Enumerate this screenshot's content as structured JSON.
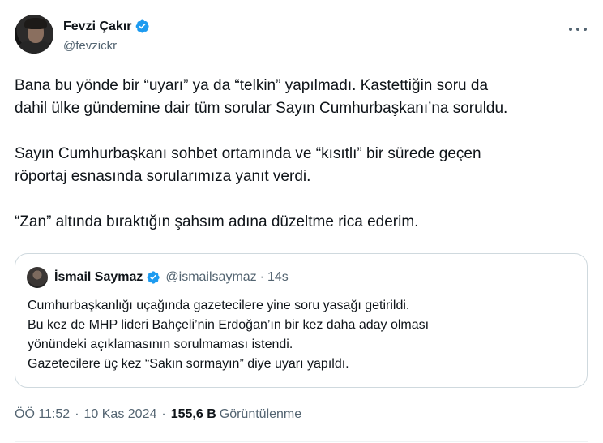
{
  "author": {
    "display_name": "Fevzi Çakır",
    "handle": "@fevzickr"
  },
  "tweet": {
    "paragraphs": [
      "Bana bu yönde bir “uyarı” ya da “telkin” yapılmadı. Kastettiğin soru da\ndahil ülke gündemine dair tüm sorular Sayın Cumhurbaşkanı’na soruldu.",
      "Sayın Cumhurbaşkanı sohbet ortamında ve “kısıtlı” bir sürede geçen\nröportaj esnasında sorularımıza yanıt verdi.",
      "“Zan” altında bıraktığın şahsım adına düzeltme rica ederim."
    ]
  },
  "quoted_tweet": {
    "display_name": "İsmail Saymaz",
    "handle": "@ismailsaymaz",
    "separator": "·",
    "time": "14s",
    "lines": [
      "Cumhurbaşkanlığı uçağında gazetecilere yine soru yasağı getirildi.",
      "Bu kez de MHP lideri Bahçeli’nin Erdoğan’ın bir kez daha aday olması",
      "yönündeki açıklamasının sorulmaması istendi.",
      "Gazetecilere üç kez “Sakın sormayın” diye uyarı yapıldı."
    ]
  },
  "meta": {
    "time": "ÖÖ 11:52",
    "separator": "·",
    "date": "10 Kas 2024",
    "views_count": "155,6 B",
    "views_label": "Görüntülenme"
  },
  "icons": {
    "verified": "verified-badge-icon",
    "more": "more-options-icon"
  },
  "colors": {
    "verified_blue": "#1d9bf0",
    "secondary_text": "#536471",
    "border": "#cfd9de"
  }
}
